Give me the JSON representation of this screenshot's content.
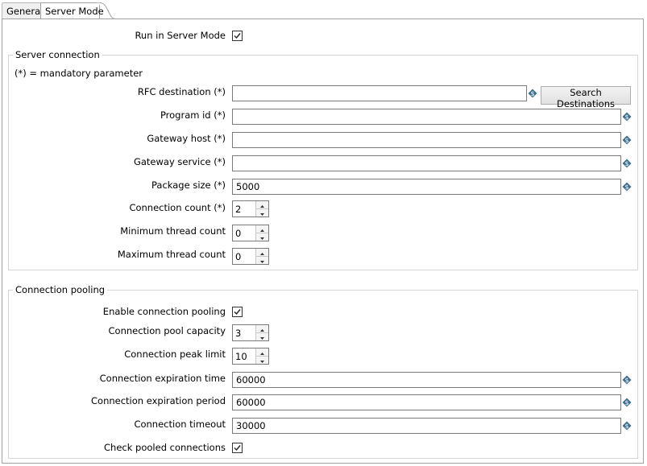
{
  "tabs": [
    {
      "label": "General",
      "active": false
    },
    {
      "label": "Server Mode",
      "active": true
    }
  ],
  "run_server_mode": {
    "label": "Run in Server Mode",
    "checked": true
  },
  "server_connection": {
    "title": "Server connection",
    "note": "(*) = mandatory parameter",
    "rfc_destination": {
      "label": "RFC destination (*)",
      "value": ""
    },
    "search_button": "Search Destinations",
    "program_id": {
      "label": "Program id (*)",
      "value": ""
    },
    "gateway_host": {
      "label": "Gateway host (*)",
      "value": ""
    },
    "gateway_service": {
      "label": "Gateway service (*)",
      "value": ""
    },
    "package_size": {
      "label": "Package size (*)",
      "value": "5000"
    },
    "connection_count": {
      "label": "Connection count (*)",
      "value": "2"
    },
    "min_thread_count": {
      "label": "Minimum thread count",
      "value": "0"
    },
    "max_thread_count": {
      "label": "Maximum thread count",
      "value": "0"
    }
  },
  "connection_pooling": {
    "title": "Connection pooling",
    "enable_pooling": {
      "label": "Enable connection pooling",
      "checked": true
    },
    "pool_capacity": {
      "label": "Connection pool capacity",
      "value": "3"
    },
    "peak_limit": {
      "label": "Connection peak limit",
      "value": "10"
    },
    "expiration_time": {
      "label": "Connection expiration time",
      "value": "60000"
    },
    "expiration_period": {
      "label": "Connection expiration period",
      "value": "60000"
    },
    "timeout": {
      "label": "Connection timeout",
      "value": "30000"
    },
    "check_pooled": {
      "label": "Check pooled connections",
      "checked": true
    }
  },
  "icons": {
    "variable": "variable-icon",
    "check": "check-icon",
    "spin_up": "arrow-up-icon",
    "spin_down": "arrow-down-icon"
  },
  "colors": {
    "variable_icon": "#3f6f8f",
    "border": "#7a7a7a",
    "group_border": "#d5d5d5"
  }
}
